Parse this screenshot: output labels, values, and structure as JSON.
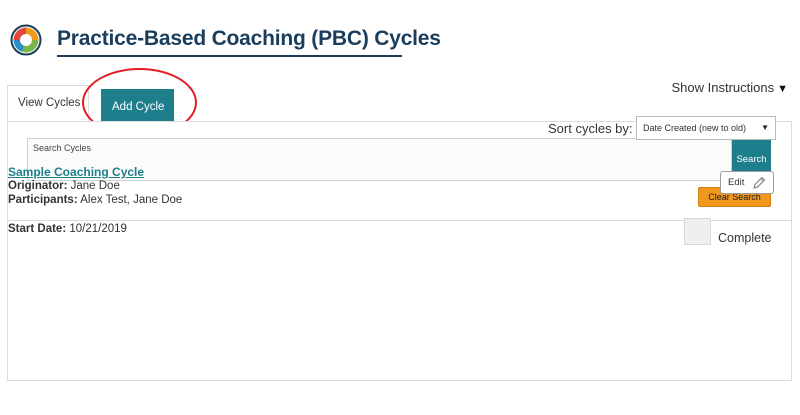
{
  "header": {
    "title": "Practice-Based Coaching (PBC) Cycles"
  },
  "instructions": {
    "label": "Show Instructions",
    "toggle_icon": "▼"
  },
  "tabs": {
    "view_cycles": "View Cycles",
    "add_cycle": "Add Cycle"
  },
  "search": {
    "placeholder": "Search Cycles",
    "search_button": "Search",
    "clear_button": "Clear Search"
  },
  "sort": {
    "label": "Sort cycles by:",
    "selected": "Date Created (new to old)",
    "arrow_icon": "▼"
  },
  "cycles": [
    {
      "name": "Sample Coaching Cycle",
      "originator_label": "Originator:",
      "originator": "Jane Doe",
      "participants_label": "Participants:",
      "participants": "Alex Test, Jane Doe",
      "start_date_label": "Start Date:",
      "start_date": "10/21/2019",
      "edit_label": "Edit",
      "complete_label": "Complete"
    }
  ],
  "colors": {
    "accent": "#1d7f8c",
    "title": "#1a3d5c",
    "clear_button": "#f0981e",
    "highlight_circle": "#e31b23"
  }
}
